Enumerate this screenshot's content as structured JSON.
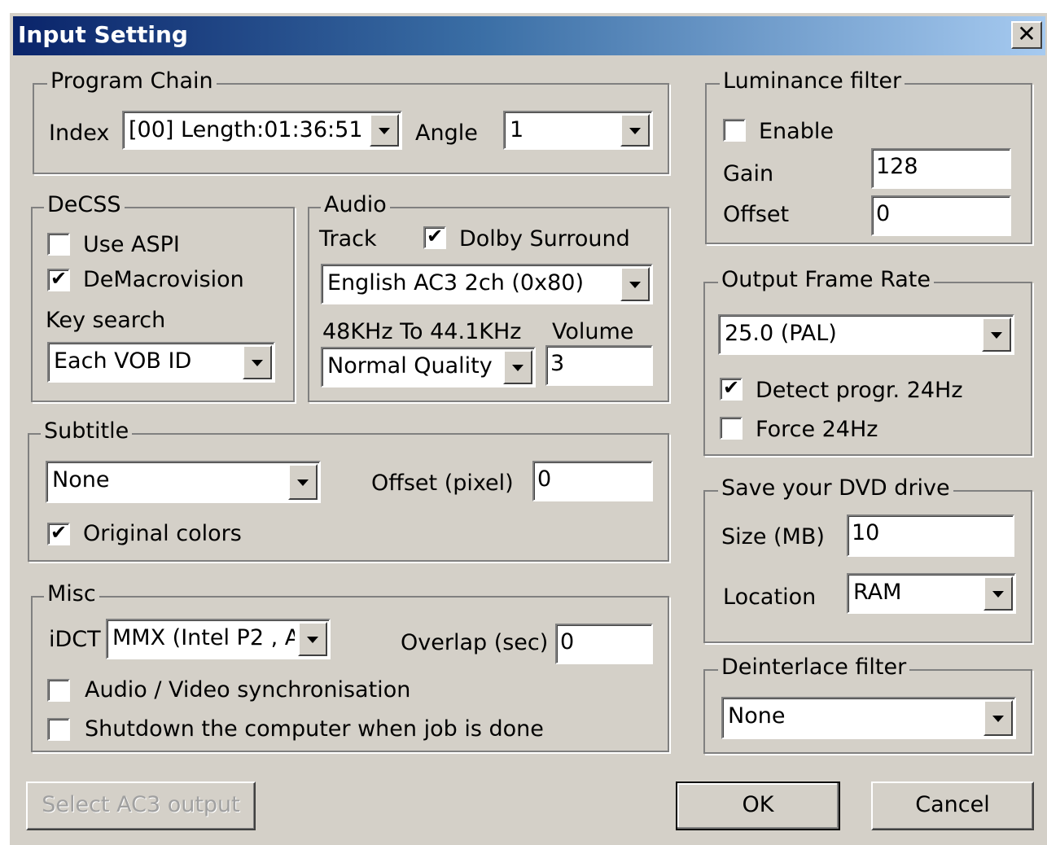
{
  "window": {
    "title": "Input Setting",
    "close_glyph": "✕"
  },
  "program_chain": {
    "legend": "Program Chain",
    "index_label": "Index",
    "index_value": "[00] Length:01:36:51",
    "angle_label": "Angle",
    "angle_value": "1"
  },
  "decss": {
    "legend": "DeCSS",
    "use_aspi_label": "Use ASPI",
    "use_aspi_checked": false,
    "demacrovision_label": "DeMacrovision",
    "demacrovision_checked": true,
    "key_search_label": "Key search",
    "key_search_value": "Each VOB ID"
  },
  "audio": {
    "legend": "Audio",
    "track_label": "Track",
    "dolby_label": "Dolby Surround",
    "dolby_checked": true,
    "track_value": "English AC3 2ch (0x80)",
    "resample_label": "48KHz To 44.1KHz",
    "volume_label": "Volume",
    "resample_value": "Normal Quality 4",
    "volume_value": "3"
  },
  "subtitle": {
    "legend": "Subtitle",
    "value": "None",
    "offset_label": "Offset (pixel)",
    "offset_value": "0",
    "original_colors_label": "Original colors",
    "original_colors_checked": true
  },
  "misc": {
    "legend": "Misc",
    "idct_label": "iDCT",
    "idct_value": "MMX (Intel P2 , A",
    "overlap_label": "Overlap (sec)",
    "overlap_value": "0",
    "av_sync_label": "Audio / Video synchronisation",
    "av_sync_checked": false,
    "shutdown_label": "Shutdown the computer when job is done",
    "shutdown_checked": false
  },
  "luminance": {
    "legend": "Luminance filter",
    "enable_label": "Enable",
    "enable_checked": false,
    "gain_label": "Gain",
    "gain_value": "128",
    "offset_label": "Offset",
    "offset_value": "0"
  },
  "frame_rate": {
    "legend": "Output Frame Rate",
    "value": "25.0  (PAL)",
    "detect_label": "Detect progr. 24Hz",
    "detect_checked": true,
    "force_label": "Force 24Hz",
    "force_checked": false
  },
  "dvd_drive": {
    "legend": "Save your DVD drive",
    "size_label": "Size (MB)",
    "size_value": "10",
    "location_label": "Location",
    "location_value": "RAM"
  },
  "deinterlace": {
    "legend": "Deinterlace filter",
    "value": "None"
  },
  "buttons": {
    "select_ac3": "Select AC3 output",
    "ok": "OK",
    "cancel": "Cancel"
  },
  "colors": {
    "face": "#d4d0c8",
    "title_start": "#0a246a",
    "title_end": "#a6caf0"
  }
}
